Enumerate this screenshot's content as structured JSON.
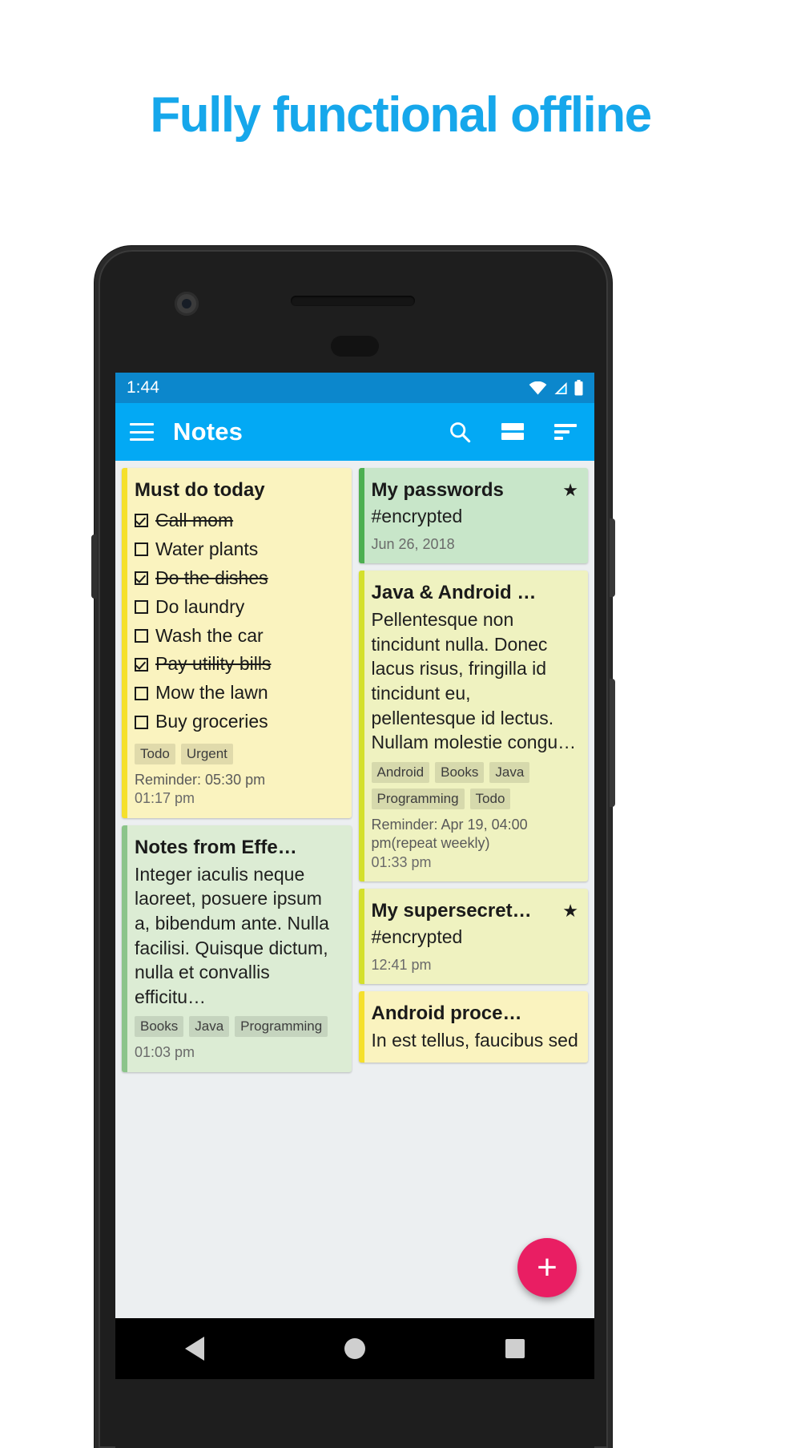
{
  "headline": "Fully functional offline",
  "colors": {
    "headline": "#16a7eb",
    "statusbar": "#0c87cc",
    "appbar": "#03a9f4",
    "fab": "#e91e63",
    "yellow_card": "#faf3bf",
    "yellow_accent": "#f5e02c",
    "green_card": "#c8e6c9",
    "green_accent": "#4caf50",
    "lime_card": "#eff2c0",
    "lime_accent": "#d4e02c",
    "pale_green_card": "#dcecd4",
    "pale_green_accent": "#8bc48a"
  },
  "statusbar": {
    "time": "1:44",
    "icons": [
      "wifi-icon",
      "signal-icon",
      "battery-icon"
    ]
  },
  "appbar": {
    "menu_icon": "hamburger-menu-icon",
    "title": "Notes",
    "actions": [
      {
        "icon": "search-icon",
        "label": "Search"
      },
      {
        "icon": "list-view-icon",
        "label": "View mode"
      },
      {
        "icon": "sort-icon",
        "label": "Sort"
      }
    ]
  },
  "fab": {
    "icon": "plus-icon",
    "label": "+"
  },
  "navbar": {
    "back": "back-triangle-icon",
    "home": "home-circle-icon",
    "recents": "recents-square-icon"
  },
  "notes": {
    "left": [
      {
        "id": "must-do-today",
        "title": "Must do today",
        "type": "checklist",
        "color": "#faf3bf",
        "accent": "#f5e02c",
        "starred": false,
        "items": [
          {
            "label": "Call mom",
            "checked": true
          },
          {
            "label": "Water plants",
            "checked": false
          },
          {
            "label": "Do the dishes",
            "checked": true
          },
          {
            "label": "Do laundry",
            "checked": false
          },
          {
            "label": "Wash the car",
            "checked": false
          },
          {
            "label": "Pay utility bills",
            "checked": true
          },
          {
            "label": "Mow the lawn",
            "checked": false
          },
          {
            "label": "Buy groceries",
            "checked": false
          }
        ],
        "tags": [
          "Todo",
          "Urgent"
        ],
        "reminder": "Reminder: 05:30 pm",
        "date": "01:17 pm"
      },
      {
        "id": "notes-from-effective-java",
        "title": "Notes from Effe…",
        "type": "text",
        "color": "#dcecd4",
        "accent": "#8bc48a",
        "starred": false,
        "body": "Integer iaculis neque laoreet, posuere ipsum a, bibendum ante. Nulla facilisi. Quisque dictum, nulla et convallis efficitu…",
        "tags": [
          "Books",
          "Java",
          "Programming"
        ],
        "reminder": "",
        "date": "01:03 pm"
      }
    ],
    "right": [
      {
        "id": "my-passwords",
        "title": "My passwords",
        "type": "text",
        "color": "#c8e6c9",
        "accent": "#4caf50",
        "starred": true,
        "body": "#encrypted",
        "tags": [],
        "reminder": "",
        "date": "Jun 26, 2018"
      },
      {
        "id": "java-and-android",
        "title": "Java & Android …",
        "type": "text",
        "color": "#eff2c0",
        "accent": "#d4e02c",
        "starred": false,
        "body": "Pellentesque non tincidunt nulla. Donec lacus risus, fringilla id tincidunt eu, pellentesque id lectus. Nullam molestie congu…",
        "tags": [
          "Android",
          "Books",
          "Java",
          "Programming",
          "Todo"
        ],
        "reminder": "Reminder: Apr 19, 04:00 pm(repeat weekly)",
        "date": "01:33 pm"
      },
      {
        "id": "my-supersecret",
        "title": "My supersecret…",
        "type": "text",
        "color": "#eff2c0",
        "accent": "#d4e02c",
        "starred": true,
        "body": "#encrypted",
        "tags": [],
        "reminder": "",
        "date": "12:41 pm"
      },
      {
        "id": "android-processes",
        "title": "Android proce…",
        "type": "text",
        "color": "#faf3bf",
        "accent": "#f5e02c",
        "starred": false,
        "body": "In est tellus, faucibus sed",
        "tags": [],
        "reminder": "",
        "date": ""
      }
    ]
  }
}
